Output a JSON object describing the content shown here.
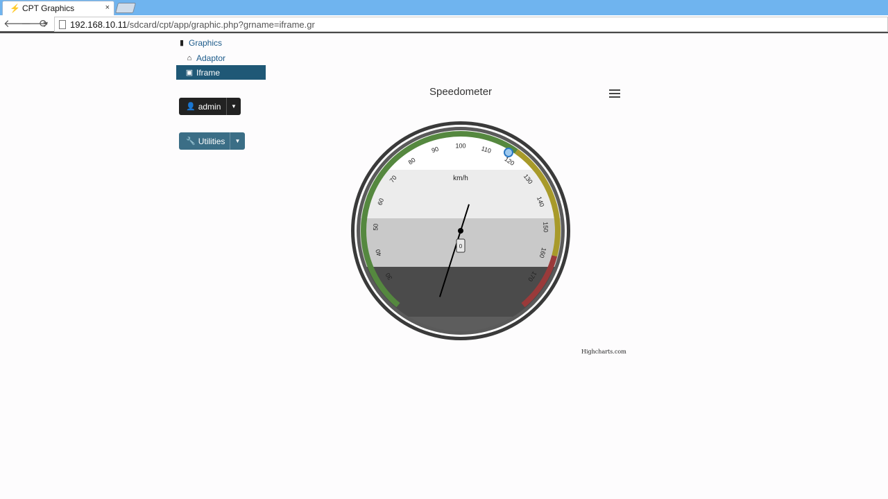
{
  "browser": {
    "tab_title": "CPT Graphics",
    "tab_close": "×",
    "url_host": "192.168.10.11",
    "url_path": "/sdcard/cpt/app/graphic.php?grname=iframe.gr",
    "icons": {
      "tab": "bolt-icon",
      "back": "back-arrow-icon",
      "forward": "forward-arrow-icon",
      "reload": "reload-icon",
      "page": "page-icon"
    }
  },
  "sidebar": {
    "items": [
      {
        "label": "Graphics",
        "icon": "book-icon"
      },
      {
        "label": "Adaptor",
        "icon": "home-icon"
      },
      {
        "label": "Iframe",
        "icon": "picture-icon"
      }
    ],
    "active_color": "#1f5876"
  },
  "buttons": {
    "admin": {
      "label": "admin",
      "icon": "user-icon"
    },
    "utilities": {
      "label": "Utilities",
      "icon": "wrench-icon"
    }
  },
  "chart": {
    "title": "Speedometer",
    "credits": "Highcharts.com",
    "menu_icon": "hamburger-menu-icon"
  },
  "chart_data": {
    "type": "gauge",
    "title": "Speedometer",
    "unit_label": "km/h",
    "min": 20,
    "max": 180,
    "tick_labels": [
      "30",
      "40",
      "50",
      "60",
      "70",
      "80",
      "90",
      "100",
      "110",
      "120",
      "130",
      "140",
      "150",
      "160",
      "170"
    ],
    "value": 110,
    "value_label": "0",
    "bands": [
      {
        "from": 20,
        "to": 120,
        "color": "#55883f"
      },
      {
        "from": 120,
        "to": 160,
        "color": "#a89a2a"
      },
      {
        "from": 160,
        "to": 180,
        "color": "#9a3a3a"
      }
    ]
  }
}
